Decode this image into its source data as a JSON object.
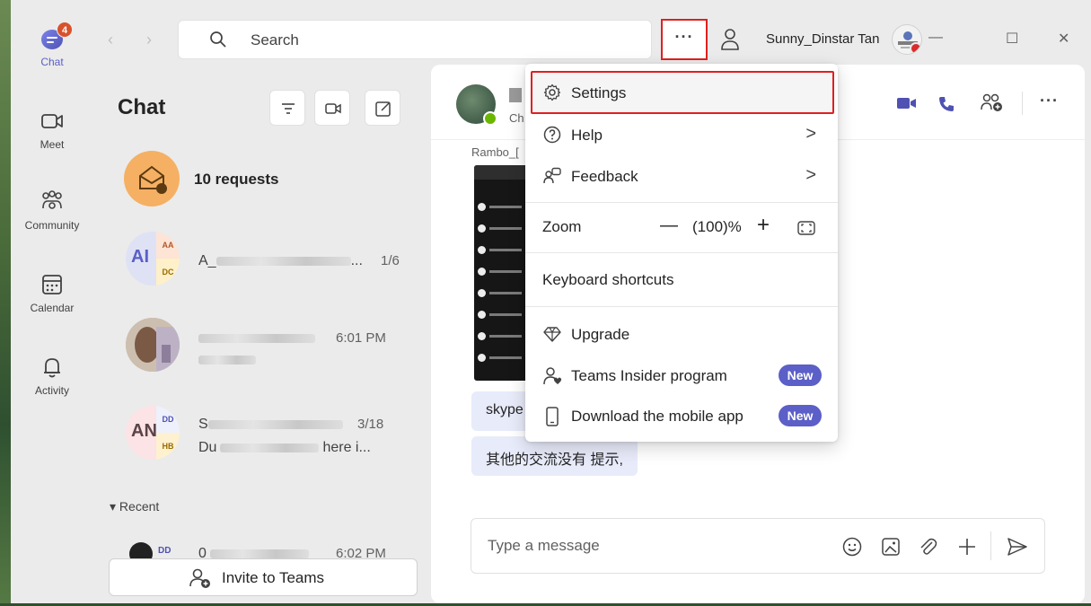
{
  "rail": {
    "chat": {
      "label": "Chat",
      "badge": "4"
    },
    "meet": {
      "label": "Meet"
    },
    "community": {
      "label": "Community"
    },
    "calendar": {
      "label": "Calendar"
    },
    "activity": {
      "label": "Activity"
    }
  },
  "topbar": {
    "search_placeholder": "Search",
    "more_glyph": "···",
    "username": "Sunny_Dinstar Tan",
    "minimize": "—",
    "maximize": "☐",
    "close": "✕"
  },
  "chatlist": {
    "title": "Chat",
    "requests_label": "10 requests",
    "rows": [
      {
        "initials": "AI",
        "mini_top": "AA",
        "mini_bottom": "DC",
        "name_prefix": "A_",
        "name_suffix": "...",
        "meta": "1/6"
      },
      {
        "meta": "6:01 PM"
      },
      {
        "initials": "AN",
        "mini_top": "DD",
        "mini_bottom": "HB",
        "name_prefix": "S",
        "meta": "3/18",
        "preview_prefix": "Du",
        "preview_suffix": "here i..."
      },
      {
        "mini_top": "DD",
        "name_prefix": "0",
        "meta": "6:02 PM"
      }
    ],
    "recent_label": "Recent",
    "invite_label": "Invite to Teams"
  },
  "conversation": {
    "subtitle": "Ch",
    "sender": "Rambo_[",
    "messages": [
      "skype",
      "其他的交流没有 提示,"
    ],
    "compose_placeholder": "Type a message",
    "more_glyph": "···"
  },
  "menu": {
    "settings": "Settings",
    "help": "Help",
    "feedback": "Feedback",
    "zoom_label": "Zoom",
    "zoom_minus": "—",
    "zoom_value": "(100)%",
    "zoom_plus": "+",
    "keyboard_shortcuts": "Keyboard shortcuts",
    "upgrade": "Upgrade",
    "insider": "Teams Insider program",
    "insider_badge": "New",
    "mobile": "Download the mobile app",
    "mobile_badge": "New",
    "chevron": ">"
  },
  "colors": {
    "accent": "#5b5fc7",
    "highlight_border": "#e02020",
    "badge": "#d9512c"
  }
}
